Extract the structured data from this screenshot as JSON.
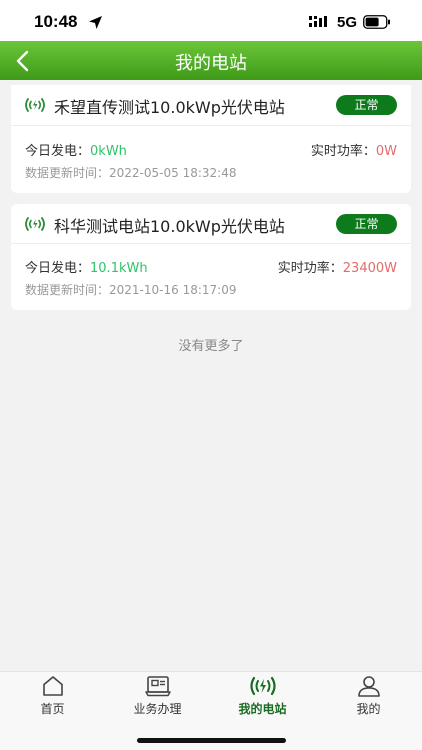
{
  "status_bar": {
    "time": "10:48",
    "network": "5G"
  },
  "nav": {
    "title": "我的电站"
  },
  "stations": [
    {
      "name": "禾望直传测试10.0kWp光伏电站",
      "status": "正常",
      "today_label": "今日发电：",
      "today_value": "0kWh",
      "power_label": "实时功率：",
      "power_value": "0W",
      "update_label": "数据更新时间：",
      "update_time": "2022-05-05 18:32:48"
    },
    {
      "name": "科华测试电站10.0kWp光伏电站",
      "status": "正常",
      "today_label": "今日发电：",
      "today_value": "10.1kWh",
      "power_label": "实时功率：",
      "power_value": "23400W",
      "update_label": "数据更新时间：",
      "update_time": "2021-10-16 18:17:09"
    }
  ],
  "list_footer": "没有更多了",
  "tabs": [
    {
      "label": "首页",
      "icon": "home-icon"
    },
    {
      "label": "业务办理",
      "icon": "business-icon"
    },
    {
      "label": "我的电站",
      "icon": "station-icon"
    },
    {
      "label": "我的",
      "icon": "user-icon"
    }
  ],
  "colors": {
    "nav_green": "#4aa822",
    "badge_green": "#0d7a1c",
    "value_green": "#2ec56a",
    "value_red": "#e46b6b",
    "tab_active": "#1c6b24"
  }
}
